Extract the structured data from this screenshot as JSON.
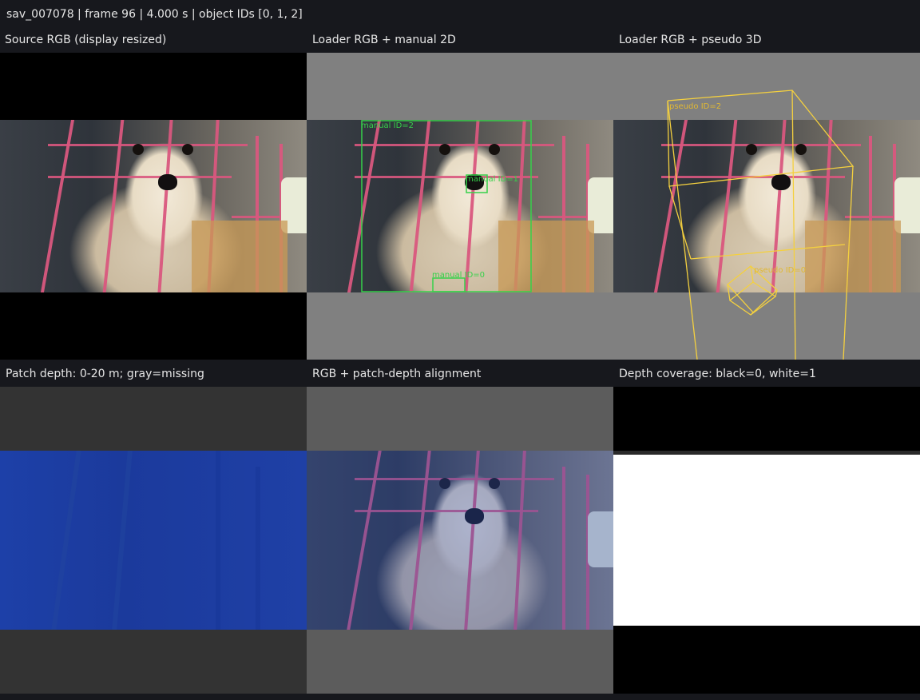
{
  "header": {
    "text": "sav_007078 | frame 96 | 4.000 s | object IDs [0, 1, 2]"
  },
  "panels": [
    {
      "title": "Source RGB (display resized)"
    },
    {
      "title": "Loader RGB + manual 2D"
    },
    {
      "title": "Loader RGB + pseudo 3D"
    },
    {
      "title": "Patch depth: 0-20 m; gray=missing"
    },
    {
      "title": "RGB + patch-depth alignment"
    },
    {
      "title": "Depth coverage: black=0, white=1"
    }
  ],
  "annotations": {
    "manual": [
      "manual ID=2",
      "manual ID=1",
      "manual ID=0"
    ],
    "pseudo": [
      "pseudo ID=2",
      "pseudo ID=0"
    ]
  },
  "colors": {
    "manual_box": "#36d14a",
    "pseudo_box": "#f4d03f",
    "depth_blue": "#1e3fa3",
    "missing_gray": "#333333"
  }
}
